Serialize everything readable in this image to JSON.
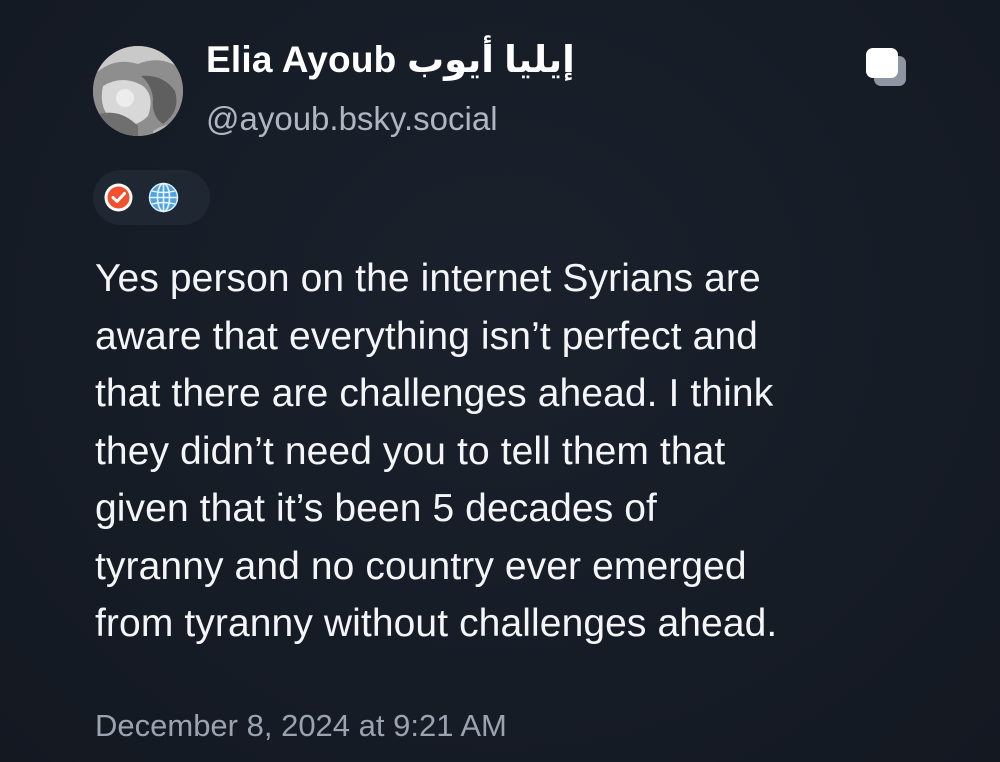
{
  "post": {
    "author": {
      "display_name": "Elia Ayoub إيليا أيوب",
      "handle": "@ayoub.bsky.social",
      "avatar_icon": "avatar-photo"
    },
    "badges": [
      {
        "icon": "verified-check-icon",
        "color": "#f2502e"
      },
      {
        "icon": "globe-icon",
        "color": "#4fa3e0"
      }
    ],
    "text_lines": [
      "Yes person on the internet Syrians are",
      "aware that everything isn’t perfect and",
      "that there are challenges ahead. I think",
      "they didn’t need you to tell them that",
      "given that it’s been 5 decades of",
      "tyranny and no country ever emerged",
      "from tyranny without challenges ahead."
    ],
    "timestamp": "December 8, 2024 at 9:21 AM",
    "actions": {
      "copy_icon": "copy-icon"
    }
  },
  "colors": {
    "background": "#161c26",
    "text": "#f4f5f7",
    "secondary_text": "#9aa3b0",
    "badge_bg": "#1f2733"
  }
}
